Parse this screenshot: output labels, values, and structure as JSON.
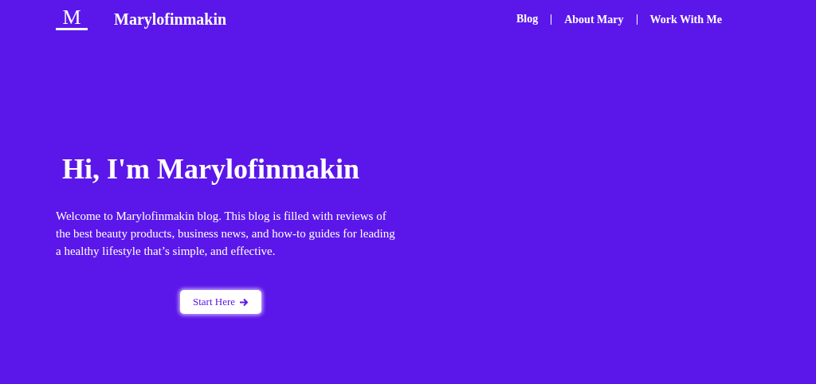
{
  "header": {
    "logo_letter": "M",
    "brand": "Marylofinmakin",
    "nav": [
      {
        "label": "Blog"
      },
      {
        "label": "About Mary"
      },
      {
        "label": "Work With Me"
      }
    ]
  },
  "hero": {
    "heading": "Hi, I'm Marylofinmakin",
    "intro": "Welcome to Marylofinmakin blog.  This blog is filled with reviews of the best beauty products, business news, and how-to guides for leading a healthy lifestyle that’s simple, and effective.",
    "button": "Start Here"
  }
}
